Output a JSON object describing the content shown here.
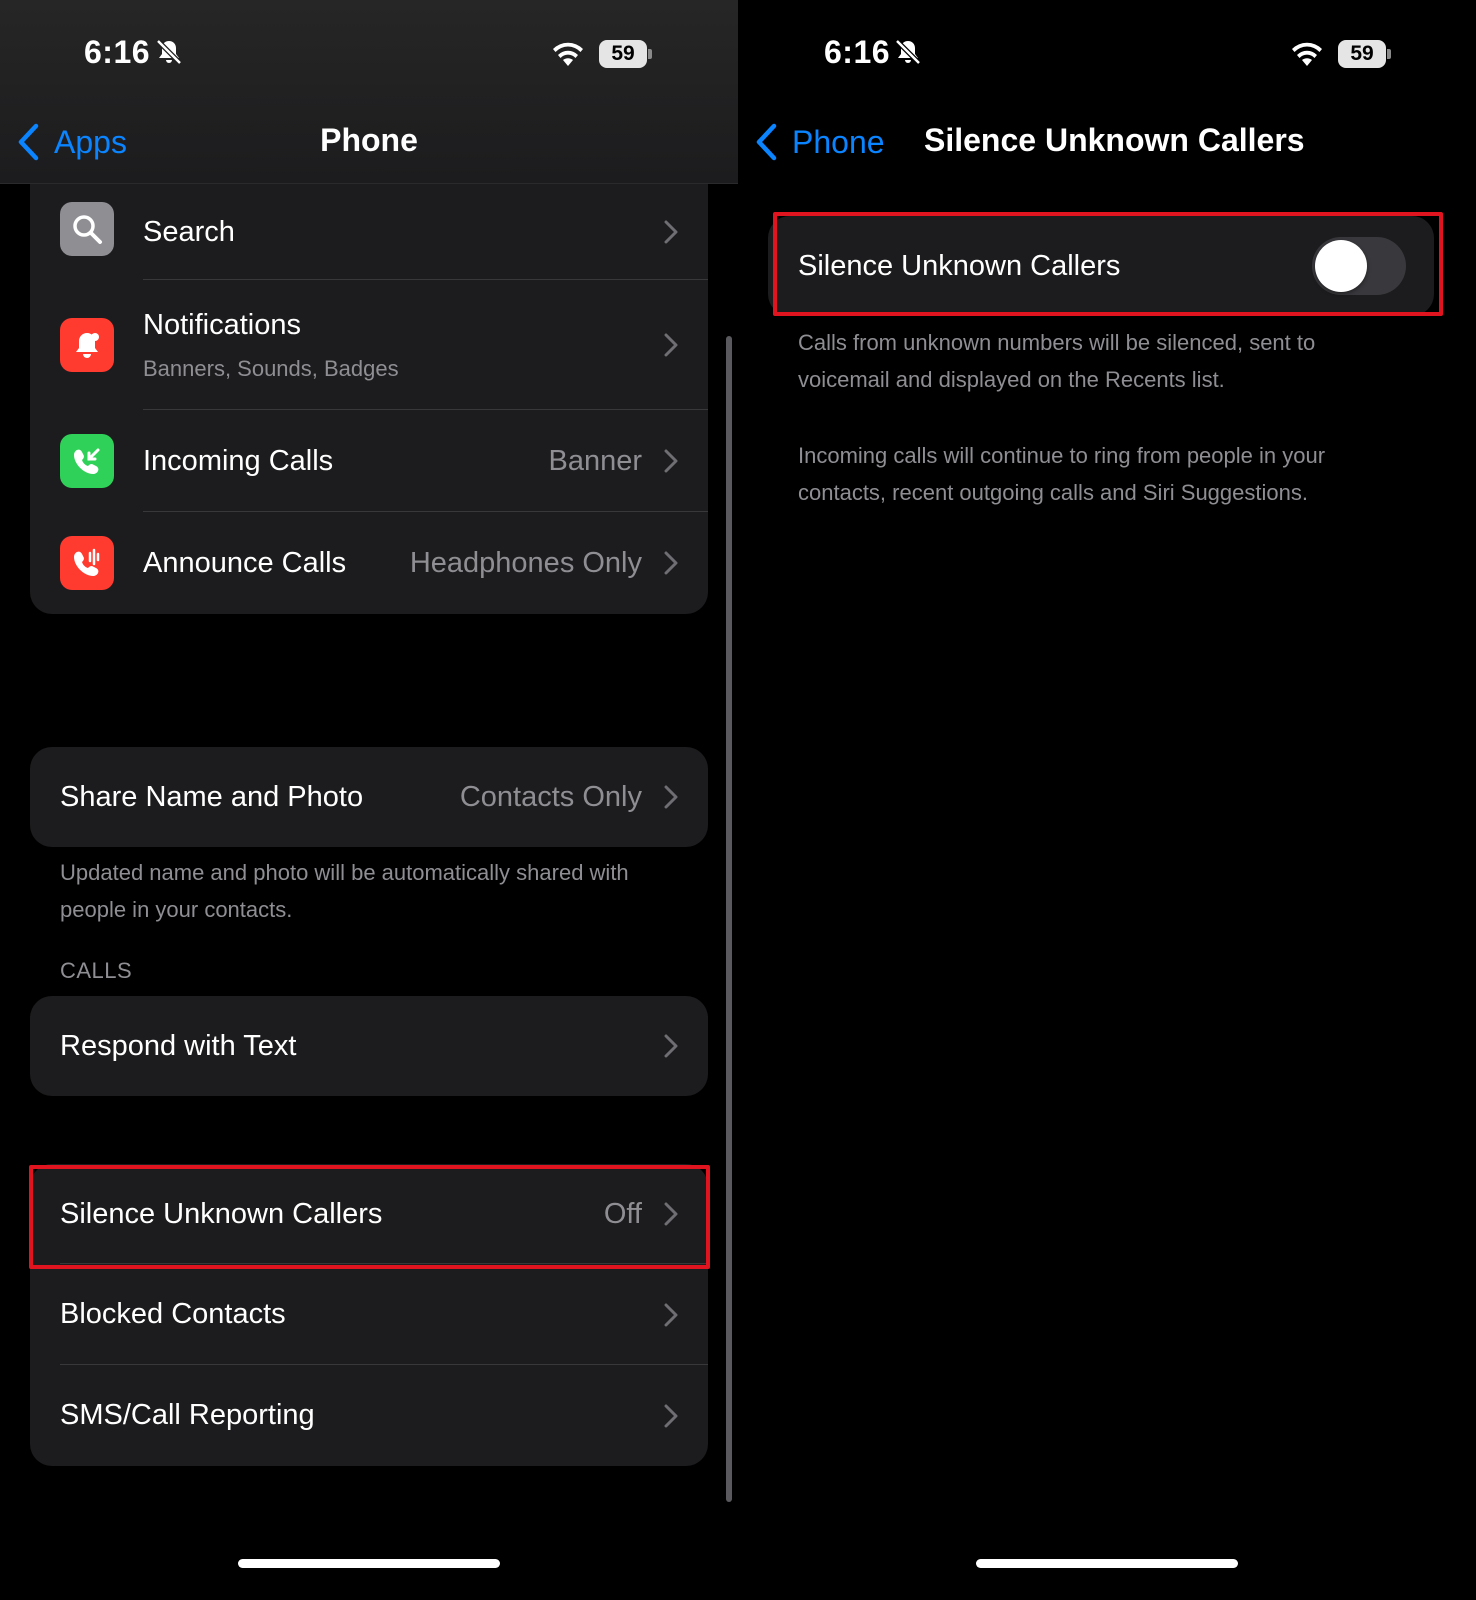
{
  "status_bar": {
    "time": "6:16",
    "battery": "59"
  },
  "left_screen": {
    "nav": {
      "back_label": "Apps",
      "title": "Phone"
    },
    "top_group": [
      {
        "label": "Search",
        "subtitle": "",
        "value": "",
        "icon": "search-icon",
        "icon_color": "#8e8e93"
      },
      {
        "label": "Notifications",
        "subtitle": "Banners, Sounds, Badges",
        "value": "",
        "icon": "notification-bell-icon",
        "icon_color": "#ff3b30"
      },
      {
        "label": "Incoming Calls",
        "subtitle": "",
        "value": "Banner",
        "icon": "incoming-call-icon",
        "icon_color": "#30d158"
      },
      {
        "label": "Announce Calls",
        "subtitle": "",
        "value": "Headphones Only",
        "icon": "announce-call-icon",
        "icon_color": "#ff3b30"
      }
    ],
    "share": {
      "label": "Share Name and Photo",
      "value": "Contacts Only",
      "footnote": "Updated name and photo will be automatically shared with people in your contacts."
    },
    "calls_section": {
      "header": "CALLS",
      "respond_label": "Respond with Text"
    },
    "bottom_group": [
      {
        "label": "Silence Unknown Callers",
        "value": "Off"
      },
      {
        "label": "Blocked Contacts",
        "value": ""
      },
      {
        "label": "SMS/Call Reporting",
        "value": ""
      }
    ]
  },
  "right_screen": {
    "nav": {
      "back_label": "Phone",
      "title": "Silence Unknown Callers"
    },
    "toggle_row": {
      "label": "Silence Unknown Callers",
      "enabled": false
    },
    "footnote_1": "Calls from unknown numbers will be silenced, sent to voicemail and displayed on the Recents list.",
    "footnote_2": "Incoming calls will continue to ring from people in your contacts, recent outgoing calls and Siri Suggestions."
  },
  "colors": {
    "accent": "#0a84ff",
    "highlight": "#e0141f",
    "cell_bg": "#1c1c1e",
    "secondary_text": "#8e8e93"
  }
}
